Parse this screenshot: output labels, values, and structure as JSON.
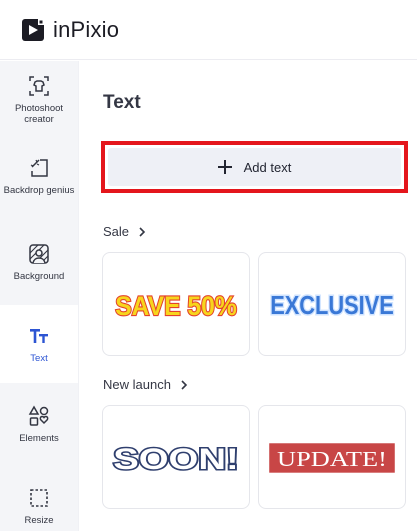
{
  "app": {
    "name": "inPixio"
  },
  "sidebar": {
    "items": [
      {
        "label": "Photoshoot creator",
        "icon": "photoshoot-icon"
      },
      {
        "label": "Backdrop genius",
        "icon": "backdrop-icon"
      },
      {
        "label": "Background",
        "icon": "background-icon"
      },
      {
        "label": "Text",
        "icon": "text-icon",
        "active": true
      },
      {
        "label": "Elements",
        "icon": "elements-icon"
      },
      {
        "label": "Resize",
        "icon": "resize-icon"
      }
    ]
  },
  "panel": {
    "title": "Text",
    "add_text_label": "Add text",
    "sections": [
      {
        "label": "Sale",
        "presets": [
          "SAVE 50%",
          "EXCLUSIVE"
        ]
      },
      {
        "label": "New launch",
        "presets": [
          "SOON!",
          "UPDATE!"
        ]
      }
    ]
  },
  "colors": {
    "accent": "#2d55d3",
    "highlight_border": "#e4161c",
    "sidebar_bg": "#f4f5f8"
  }
}
